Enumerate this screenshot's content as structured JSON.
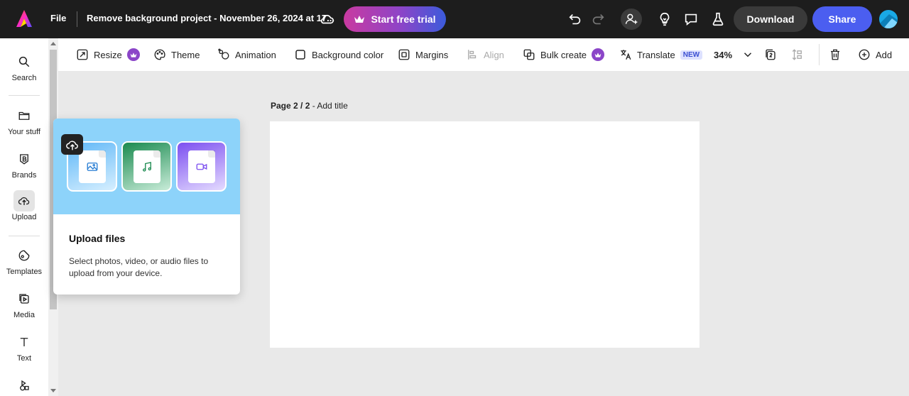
{
  "topbar": {
    "file_label": "File",
    "doc_title": "Remove background project - November 26, 2024 at 17...",
    "trial_label": "Start free trial",
    "download_label": "Download",
    "share_label": "Share",
    "icons": [
      "adobe-express-logo",
      "cloud-icon",
      "undo-icon",
      "redo-icon",
      "invite-icon",
      "lightbulb-icon",
      "comment-icon",
      "flask-icon"
    ]
  },
  "rail": {
    "items": [
      {
        "label": "Search",
        "icon": "search-icon"
      },
      {
        "label": "Your stuff",
        "icon": "folder-icon"
      },
      {
        "label": "Brands",
        "icon": "brand-icon"
      },
      {
        "label": "Upload",
        "icon": "upload-icon",
        "active": true
      },
      {
        "label": "Templates",
        "icon": "templates-icon"
      },
      {
        "label": "Media",
        "icon": "media-icon"
      },
      {
        "label": "Text",
        "icon": "text-icon"
      },
      {
        "label": "",
        "icon": "elements-icon"
      }
    ]
  },
  "toolbar": {
    "resize": "Resize",
    "theme": "Theme",
    "animation": "Animation",
    "background_color": "Background color",
    "margins": "Margins",
    "align": "Align",
    "bulk_create": "Bulk create",
    "translate": "Translate",
    "new_badge": "NEW",
    "zoom": "34%",
    "add": "Add"
  },
  "canvas": {
    "page_indicator": "Page 2 / 2",
    "page_title_placeholder": " - Add title"
  },
  "upload_popup": {
    "title": "Upload files",
    "description": "Select photos, video, or audio files to upload from your device.",
    "tiles": [
      "image-file-icon",
      "audio-file-icon",
      "video-file-icon"
    ]
  },
  "colors": {
    "topbar_bg": "#1d1d1d",
    "share_blue": "#4b5ef0",
    "premium_purple": "#8b45c8",
    "popup_hero": "#8dd3fa",
    "canvas_bg": "#e9e9e9"
  }
}
